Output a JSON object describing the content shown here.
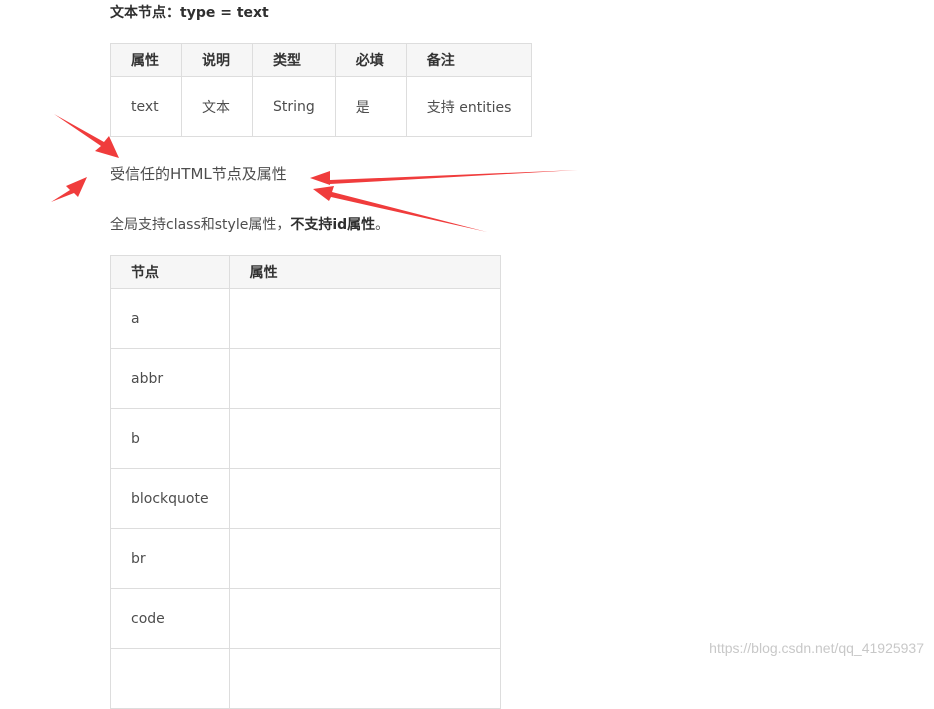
{
  "text_node": {
    "heading": "文本节点：type = text",
    "table": {
      "headers": [
        "属性",
        "说明",
        "类型",
        "必填",
        "备注"
      ],
      "row": [
        "text",
        "文本",
        "String",
        "是",
        "支持 entities"
      ]
    }
  },
  "trusted": {
    "title": "受信任的HTML节点及属性",
    "global_prefix": "全局支持class和style属性，",
    "global_bold": "不支持id属性",
    "global_suffix": "。",
    "table": {
      "headers": [
        "节点",
        "属性"
      ],
      "rows": [
        [
          "a",
          ""
        ],
        [
          "abbr",
          ""
        ],
        [
          "b",
          ""
        ],
        [
          "blockquote",
          ""
        ],
        [
          "br",
          ""
        ],
        [
          "code",
          ""
        ],
        [
          "",
          ""
        ]
      ]
    }
  },
  "annotation": {
    "arrow_color": "#f03c3c"
  },
  "watermark": "https://blog.csdn.net/qq_41925937"
}
